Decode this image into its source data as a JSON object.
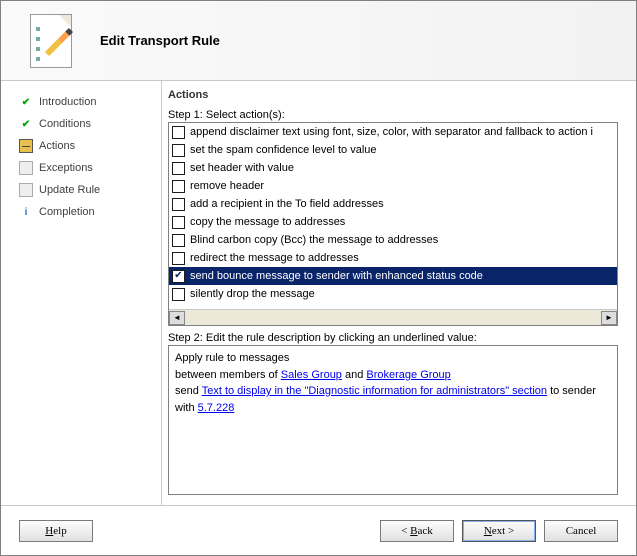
{
  "header": {
    "title": "Edit Transport Rule"
  },
  "nav": {
    "items": [
      {
        "label": "Introduction",
        "icon": "done"
      },
      {
        "label": "Conditions",
        "icon": "done"
      },
      {
        "label": "Actions",
        "icon": "current"
      },
      {
        "label": "Exceptions",
        "icon": "pending"
      },
      {
        "label": "Update Rule",
        "icon": "pending"
      },
      {
        "label": "Completion",
        "icon": "info"
      }
    ]
  },
  "main": {
    "panel_title": "Actions",
    "step1_label": "Step 1: Select action(s):",
    "actions": [
      {
        "label": "append disclaimer text using font, size, color, with separator and fallback to action i",
        "checked": false
      },
      {
        "label": "set the spam confidence level to value",
        "checked": false
      },
      {
        "label": "set header with value",
        "checked": false
      },
      {
        "label": "remove header",
        "checked": false
      },
      {
        "label": "add a recipient in the To field addresses",
        "checked": false
      },
      {
        "label": "copy the message to addresses",
        "checked": false
      },
      {
        "label": "Blind carbon copy (Bcc) the message to addresses",
        "checked": false
      },
      {
        "label": "redirect the message to addresses",
        "checked": false
      },
      {
        "label": "send bounce message to sender with enhanced status code",
        "checked": true,
        "selected": true
      },
      {
        "label": "silently drop the message",
        "checked": false
      }
    ],
    "step2_label": "Step 2: Edit the rule description by clicking an underlined value:",
    "desc": {
      "line1": "Apply rule to messages",
      "line2_a": "between members of ",
      "line2_link1": "Sales Group",
      "line2_b": " and ",
      "line2_link2": "Brokerage Group",
      "line3_a": "send ",
      "line3_link1": "Text to display in the \"Diagnostic information for administrators\" section",
      "line3_b": " to sender with ",
      "line3_link2": "5.7.228"
    }
  },
  "footer": {
    "help": "Help",
    "back": "Back",
    "next": "Next",
    "cancel": "Cancel"
  }
}
